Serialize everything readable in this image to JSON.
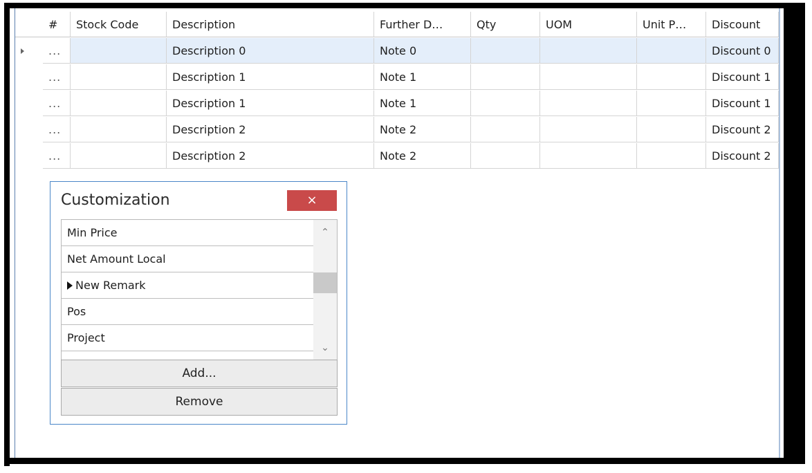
{
  "grid": {
    "columns": [
      "#",
      "Stock Code",
      "Description",
      "Further D…",
      "Qty",
      "UOM",
      "Unit P…",
      "Discount"
    ],
    "rows": [
      {
        "dots": "...",
        "stock_code": "",
        "description": "Description 0",
        "further": "Note 0",
        "qty": "",
        "uom": "",
        "unit_price": "",
        "discount": "Discount 0"
      },
      {
        "dots": "...",
        "stock_code": "",
        "description": "Description 1",
        "further": "Note 1",
        "qty": "",
        "uom": "",
        "unit_price": "",
        "discount": "Discount 1"
      },
      {
        "dots": "...",
        "stock_code": "",
        "description": "Description 1",
        "further": "Note 1",
        "qty": "",
        "uom": "",
        "unit_price": "",
        "discount": "Discount 1"
      },
      {
        "dots": "...",
        "stock_code": "",
        "description": "Description 2",
        "further": "Note 2",
        "qty": "",
        "uom": "",
        "unit_price": "",
        "discount": "Discount 2"
      },
      {
        "dots": "...",
        "stock_code": "",
        "description": "Description 2",
        "further": "Note 2",
        "qty": "",
        "uom": "",
        "unit_price": "",
        "discount": "Discount 2"
      }
    ],
    "selected_row": 0
  },
  "customization": {
    "title": "Customization",
    "close_label": "×",
    "items": [
      "Min Price",
      "Net Amount Local",
      "New Remark",
      "Pos",
      "Project"
    ],
    "selected_item": 2,
    "add_label": "Add...",
    "remove_label": "Remove"
  },
  "colors": {
    "selection": "#e4eefa",
    "close_button": "#c94a4a",
    "dialog_border": "#4a86c8"
  }
}
